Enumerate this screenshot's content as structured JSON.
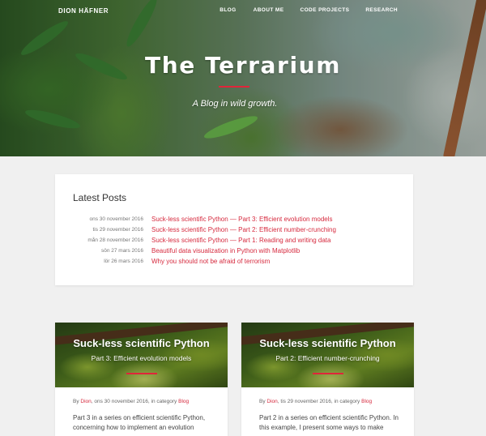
{
  "nav": {
    "brand": "DION HÄFNER",
    "items": [
      "BLOG",
      "ABOUT ME",
      "CODE PROJECTS",
      "RESEARCH"
    ]
  },
  "hero": {
    "title": "The Terrarium",
    "subtitle": "A Blog in wild growth."
  },
  "latest": {
    "title": "Latest Posts",
    "posts": [
      {
        "date": "ons 30 november 2016",
        "title": "Suck-less scientific Python — Part 3: Efficient evolution models"
      },
      {
        "date": "tis 29 november 2016",
        "title": "Suck-less scientific Python — Part 2: Efficient number-crunching"
      },
      {
        "date": "mån 28 november 2016",
        "title": "Suck-less scientific Python — Part 1: Reading and writing data"
      },
      {
        "date": "sön 27 mars 2016",
        "title": "Beautiful data visualization in Python with Matplotlib"
      },
      {
        "date": "lör 26 mars 2016",
        "title": "Why you should not be afraid of terrorism"
      }
    ]
  },
  "cards": [
    {
      "title": "Suck-less scientific Python",
      "subtitle": "Part 3: Efficient evolution models",
      "meta_by": "By ",
      "author": "Dion",
      "meta_date": ", ons 30 november 2016, in category ",
      "category": "Blog",
      "excerpt": "Part 3 in a series on efficient scientific Python, concerning how to implement an evolution"
    },
    {
      "title": "Suck-less scientific Python",
      "subtitle": "Part 2: Efficient number-crunching",
      "meta_by": "By ",
      "author": "Dion",
      "meta_date": ", tis 29 november 2016, in category ",
      "category": "Blog",
      "excerpt": "Part 2 in a series on efficient scientific Python. In this example, I present some ways to make"
    }
  ],
  "colors": {
    "accent": "#e0253a",
    "link": "#d62a3e",
    "background": "#f0f0f0"
  }
}
